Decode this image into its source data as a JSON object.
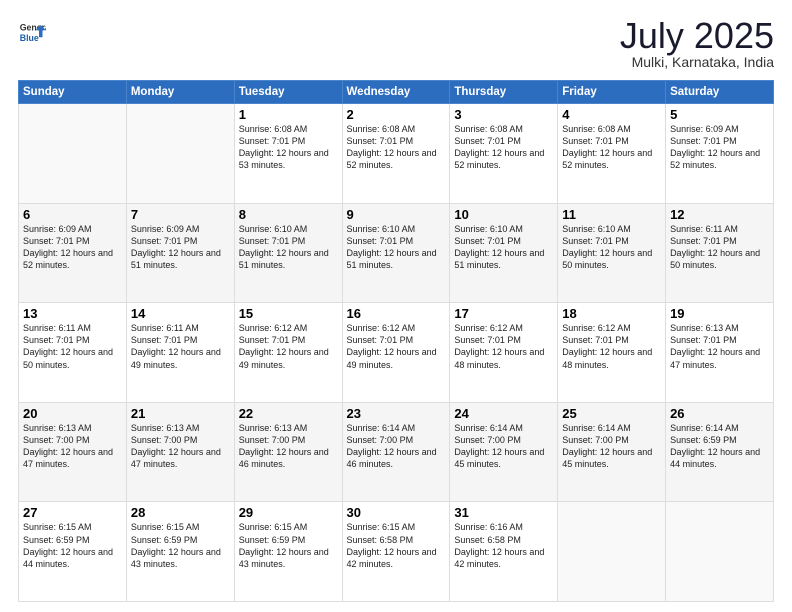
{
  "header": {
    "logo_general": "General",
    "logo_blue": "Blue",
    "month_title": "July 2025",
    "location": "Mulki, Karnataka, India"
  },
  "weekdays": [
    "Sunday",
    "Monday",
    "Tuesday",
    "Wednesday",
    "Thursday",
    "Friday",
    "Saturday"
  ],
  "weeks": [
    [
      {
        "day": "",
        "info": ""
      },
      {
        "day": "",
        "info": ""
      },
      {
        "day": "1",
        "info": "Sunrise: 6:08 AM\nSunset: 7:01 PM\nDaylight: 12 hours and 53 minutes."
      },
      {
        "day": "2",
        "info": "Sunrise: 6:08 AM\nSunset: 7:01 PM\nDaylight: 12 hours and 52 minutes."
      },
      {
        "day": "3",
        "info": "Sunrise: 6:08 AM\nSunset: 7:01 PM\nDaylight: 12 hours and 52 minutes."
      },
      {
        "day": "4",
        "info": "Sunrise: 6:08 AM\nSunset: 7:01 PM\nDaylight: 12 hours and 52 minutes."
      },
      {
        "day": "5",
        "info": "Sunrise: 6:09 AM\nSunset: 7:01 PM\nDaylight: 12 hours and 52 minutes."
      }
    ],
    [
      {
        "day": "6",
        "info": "Sunrise: 6:09 AM\nSunset: 7:01 PM\nDaylight: 12 hours and 52 minutes."
      },
      {
        "day": "7",
        "info": "Sunrise: 6:09 AM\nSunset: 7:01 PM\nDaylight: 12 hours and 51 minutes."
      },
      {
        "day": "8",
        "info": "Sunrise: 6:10 AM\nSunset: 7:01 PM\nDaylight: 12 hours and 51 minutes."
      },
      {
        "day": "9",
        "info": "Sunrise: 6:10 AM\nSunset: 7:01 PM\nDaylight: 12 hours and 51 minutes."
      },
      {
        "day": "10",
        "info": "Sunrise: 6:10 AM\nSunset: 7:01 PM\nDaylight: 12 hours and 51 minutes."
      },
      {
        "day": "11",
        "info": "Sunrise: 6:10 AM\nSunset: 7:01 PM\nDaylight: 12 hours and 50 minutes."
      },
      {
        "day": "12",
        "info": "Sunrise: 6:11 AM\nSunset: 7:01 PM\nDaylight: 12 hours and 50 minutes."
      }
    ],
    [
      {
        "day": "13",
        "info": "Sunrise: 6:11 AM\nSunset: 7:01 PM\nDaylight: 12 hours and 50 minutes."
      },
      {
        "day": "14",
        "info": "Sunrise: 6:11 AM\nSunset: 7:01 PM\nDaylight: 12 hours and 49 minutes."
      },
      {
        "day": "15",
        "info": "Sunrise: 6:12 AM\nSunset: 7:01 PM\nDaylight: 12 hours and 49 minutes."
      },
      {
        "day": "16",
        "info": "Sunrise: 6:12 AM\nSunset: 7:01 PM\nDaylight: 12 hours and 49 minutes."
      },
      {
        "day": "17",
        "info": "Sunrise: 6:12 AM\nSunset: 7:01 PM\nDaylight: 12 hours and 48 minutes."
      },
      {
        "day": "18",
        "info": "Sunrise: 6:12 AM\nSunset: 7:01 PM\nDaylight: 12 hours and 48 minutes."
      },
      {
        "day": "19",
        "info": "Sunrise: 6:13 AM\nSunset: 7:01 PM\nDaylight: 12 hours and 47 minutes."
      }
    ],
    [
      {
        "day": "20",
        "info": "Sunrise: 6:13 AM\nSunset: 7:00 PM\nDaylight: 12 hours and 47 minutes."
      },
      {
        "day": "21",
        "info": "Sunrise: 6:13 AM\nSunset: 7:00 PM\nDaylight: 12 hours and 47 minutes."
      },
      {
        "day": "22",
        "info": "Sunrise: 6:13 AM\nSunset: 7:00 PM\nDaylight: 12 hours and 46 minutes."
      },
      {
        "day": "23",
        "info": "Sunrise: 6:14 AM\nSunset: 7:00 PM\nDaylight: 12 hours and 46 minutes."
      },
      {
        "day": "24",
        "info": "Sunrise: 6:14 AM\nSunset: 7:00 PM\nDaylight: 12 hours and 45 minutes."
      },
      {
        "day": "25",
        "info": "Sunrise: 6:14 AM\nSunset: 7:00 PM\nDaylight: 12 hours and 45 minutes."
      },
      {
        "day": "26",
        "info": "Sunrise: 6:14 AM\nSunset: 6:59 PM\nDaylight: 12 hours and 44 minutes."
      }
    ],
    [
      {
        "day": "27",
        "info": "Sunrise: 6:15 AM\nSunset: 6:59 PM\nDaylight: 12 hours and 44 minutes."
      },
      {
        "day": "28",
        "info": "Sunrise: 6:15 AM\nSunset: 6:59 PM\nDaylight: 12 hours and 43 minutes."
      },
      {
        "day": "29",
        "info": "Sunrise: 6:15 AM\nSunset: 6:59 PM\nDaylight: 12 hours and 43 minutes."
      },
      {
        "day": "30",
        "info": "Sunrise: 6:15 AM\nSunset: 6:58 PM\nDaylight: 12 hours and 42 minutes."
      },
      {
        "day": "31",
        "info": "Sunrise: 6:16 AM\nSunset: 6:58 PM\nDaylight: 12 hours and 42 minutes."
      },
      {
        "day": "",
        "info": ""
      },
      {
        "day": "",
        "info": ""
      }
    ]
  ]
}
